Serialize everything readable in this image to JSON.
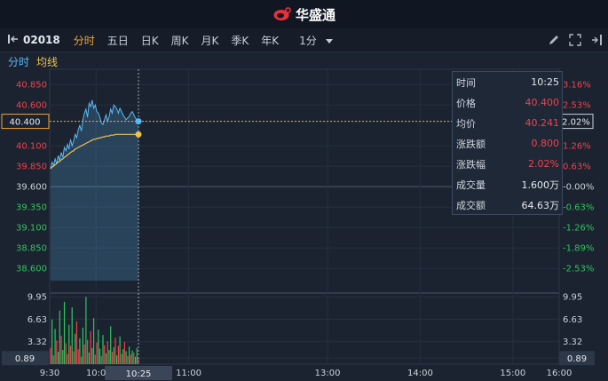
{
  "app": {
    "title": "华盛通"
  },
  "toolbar": {
    "code": "02018",
    "tabs": [
      {
        "label": "分时",
        "active": true
      },
      {
        "label": "五日",
        "active": false
      },
      {
        "label": "日K",
        "active": false
      },
      {
        "label": "周K",
        "active": false
      },
      {
        "label": "月K",
        "active": false
      },
      {
        "label": "季K",
        "active": false
      },
      {
        "label": "年K",
        "active": false
      }
    ],
    "interval": "1分"
  },
  "subbar": {
    "minute_label": "分时",
    "avg_label": "均线"
  },
  "colors": {
    "price": "#5ab8f4",
    "avg": "#f2c14a",
    "up": "#f2404a",
    "down": "#2ec45c",
    "accent": "#f2a53a"
  },
  "chart_data": {
    "type": "line",
    "price_ticks": [
      "40.850",
      "40.600",
      "40.400",
      "40.100",
      "39.850",
      "39.600",
      "39.350",
      "39.100",
      "38.850",
      "38.600"
    ],
    "pct_ticks": [
      "3.16%",
      "2.53%",
      "2.02%",
      "1.26%",
      "0.63%",
      "-0.00%",
      "-0.63%",
      "-1.26%",
      "-1.89%",
      "-2.53%"
    ],
    "volume_ticks": [
      "9.95",
      "6.63",
      "3.32",
      "0.89"
    ],
    "time_ticks": [
      "9:30",
      "10:0",
      "11:00",
      "13:00",
      "14:00",
      "15:00",
      "16:00"
    ],
    "crosshair": {
      "price": "40.400",
      "pct": "2.02%",
      "time": "10:25",
      "volume": "0.89"
    },
    "ylim": [
      38.45,
      40.95
    ],
    "prev_close": 39.6,
    "price_values": [
      39.82,
      39.9,
      39.86,
      39.94,
      39.88,
      39.98,
      39.92,
      40.02,
      39.96,
      40.08,
      40.04,
      40.12,
      40.06,
      40.18,
      40.1,
      40.16,
      40.24,
      40.2,
      40.3,
      40.35,
      40.28,
      40.42,
      40.5,
      40.55,
      40.45,
      40.62,
      40.58,
      40.66,
      40.56,
      40.6,
      40.52,
      40.5,
      40.45,
      40.38,
      40.36,
      40.42,
      40.48,
      40.4,
      40.46,
      40.55,
      40.5,
      40.6,
      40.58,
      40.55,
      40.5,
      40.56,
      40.52,
      40.48,
      40.45,
      40.42,
      40.44,
      40.46,
      40.5,
      40.52,
      40.48,
      40.44,
      40.42,
      40.4
    ],
    "avg_values": [
      39.82,
      39.84,
      39.85,
      39.87,
      39.88,
      39.9,
      39.91,
      39.93,
      39.94,
      39.96,
      39.97,
      39.99,
      40.0,
      40.02,
      40.03,
      40.04,
      40.06,
      40.07,
      40.08,
      40.09,
      40.1,
      40.11,
      40.12,
      40.13,
      40.14,
      40.15,
      40.16,
      40.17,
      40.18,
      40.18,
      40.19,
      40.19,
      40.2,
      40.2,
      40.21,
      40.21,
      40.22,
      40.22,
      40.22,
      40.23,
      40.23,
      40.23,
      40.24,
      40.24,
      40.24,
      40.24,
      40.24,
      40.24,
      40.24,
      40.24,
      40.24,
      40.24,
      40.24,
      40.24,
      40.24,
      40.24,
      40.24,
      40.24
    ],
    "volume_values": [
      2.4,
      6.6,
      1.3,
      5.2,
      3.5,
      1.8,
      7.9,
      4.2,
      2.1,
      9.2,
      3.1,
      1.5,
      5.8,
      2.7,
      8.4,
      1.9,
      4.5,
      6.3,
      2.2,
      3.8,
      1.1,
      5.4,
      2.9,
      9.95,
      3.6,
      1.7,
      4.9,
      2.4,
      6.8,
      1.4,
      3.2,
      5.1,
      2.3,
      1.2,
      4.3,
      2.8,
      1.6,
      3.4,
      2.1,
      5.6,
      1.8,
      2.5,
      3.9,
      1.3,
      2.7,
      4.1,
      1.5,
      2.2,
      3.3,
      1.9,
      1.2,
      2.6,
      1.4,
      2.0,
      1.7,
      1.1,
      2.4,
      0.89
    ],
    "volume_up": [
      1,
      0,
      1,
      0,
      1,
      0,
      0,
      1,
      0,
      0,
      1,
      1,
      0,
      1,
      0,
      1,
      0,
      1,
      1,
      0,
      1,
      0,
      1,
      0,
      1,
      0,
      1,
      0,
      0,
      1,
      1,
      0,
      0,
      1,
      0,
      1,
      0,
      1,
      0,
      0,
      1,
      0,
      1,
      0,
      1,
      0,
      1,
      0,
      1,
      0,
      1,
      0,
      1,
      0,
      1,
      0,
      0,
      1
    ]
  },
  "info_panel": {
    "rows": [
      {
        "label": "时间",
        "value": "10:25",
        "red": false
      },
      {
        "label": "价格",
        "value": "40.400",
        "red": true
      },
      {
        "label": "均价",
        "value": "40.241",
        "red": true
      },
      {
        "label": "涨跌额",
        "value": "0.800",
        "red": true
      },
      {
        "label": "涨跌幅",
        "value": "2.02%",
        "red": true
      },
      {
        "label": "成交量",
        "value": "1.600万",
        "red": false
      },
      {
        "label": "成交额",
        "value": "64.63万",
        "red": false
      }
    ]
  }
}
